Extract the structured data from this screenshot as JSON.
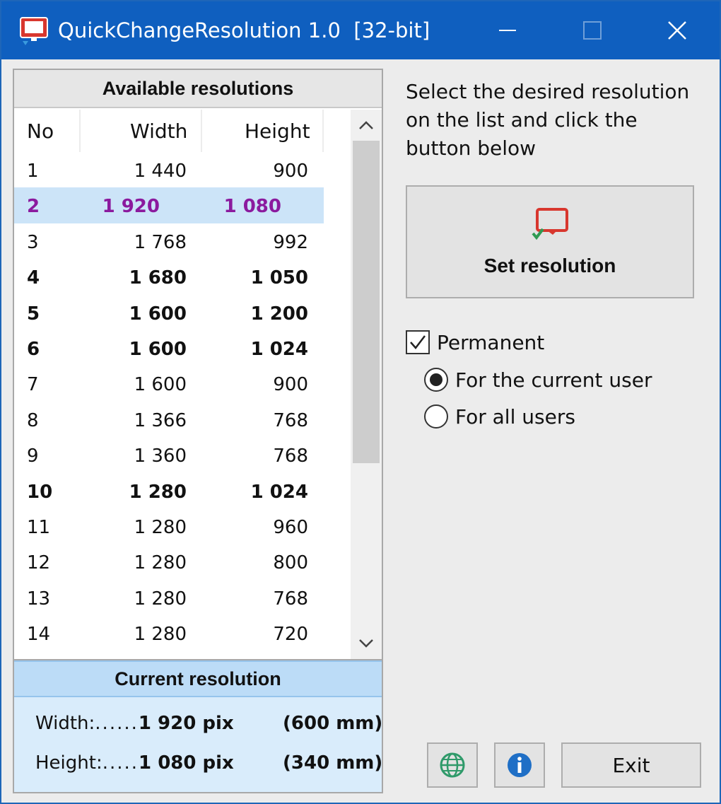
{
  "window": {
    "title": "QuickChangeResolution 1.0  [32-bit]",
    "accent_color": "#0f5fbf",
    "icons": {
      "app": "monitor-icon",
      "minimize": "minimize-icon",
      "maximize": "maximize-icon",
      "close": "close-icon"
    }
  },
  "list": {
    "header": "Available resolutions",
    "columns": {
      "no": "No",
      "width": "Width",
      "height": "Height"
    },
    "selected_color": "#8b1a9e",
    "rows": [
      {
        "no": "1",
        "width": "1 440",
        "height": "900",
        "bold": false,
        "selected": false
      },
      {
        "no": "2",
        "width": "1 920",
        "height": "1 080",
        "bold": true,
        "selected": true
      },
      {
        "no": "3",
        "width": "1 768",
        "height": "992",
        "bold": false,
        "selected": false
      },
      {
        "no": "4",
        "width": "1 680",
        "height": "1 050",
        "bold": true,
        "selected": false
      },
      {
        "no": "5",
        "width": "1 600",
        "height": "1 200",
        "bold": true,
        "selected": false
      },
      {
        "no": "6",
        "width": "1 600",
        "height": "1 024",
        "bold": true,
        "selected": false
      },
      {
        "no": "7",
        "width": "1 600",
        "height": "900",
        "bold": false,
        "selected": false
      },
      {
        "no": "8",
        "width": "1 366",
        "height": "768",
        "bold": false,
        "selected": false
      },
      {
        "no": "9",
        "width": "1 360",
        "height": "768",
        "bold": false,
        "selected": false
      },
      {
        "no": "10",
        "width": "1 280",
        "height": "1 024",
        "bold": true,
        "selected": false
      },
      {
        "no": "11",
        "width": "1 280",
        "height": "960",
        "bold": false,
        "selected": false
      },
      {
        "no": "12",
        "width": "1 280",
        "height": "800",
        "bold": false,
        "selected": false
      },
      {
        "no": "13",
        "width": "1 280",
        "height": "768",
        "bold": false,
        "selected": false
      },
      {
        "no": "14",
        "width": "1 280",
        "height": "720",
        "bold": false,
        "selected": false
      }
    ]
  },
  "current": {
    "header": "Current resolution",
    "width_label": "Width:",
    "width_dots": "......",
    "width_value": "1 920 pix",
    "width_mm": "(600 mm)",
    "height_label": "Height:",
    "height_dots": ".....",
    "height_value": "1 080 pix",
    "height_mm": "(340 mm)"
  },
  "panel": {
    "instructions": "Select the desired resolution on the list and click the button below",
    "set_button_label": "Set resolution",
    "permanent_label": "Permanent",
    "permanent_checked": true,
    "radio_current_user": "For the current user",
    "radio_all_users": "For all users",
    "selected_radio": "current_user",
    "exit_label": "Exit",
    "icons": {
      "set": "monitor-check-icon",
      "language": "globe-icon",
      "about": "info-icon"
    }
  }
}
